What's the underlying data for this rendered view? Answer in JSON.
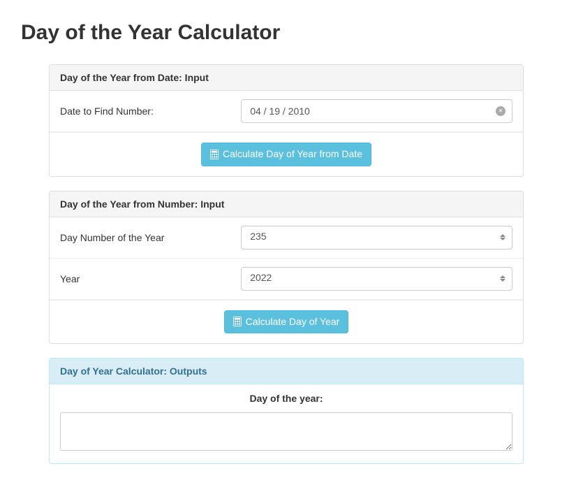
{
  "page_title": "Day of the Year Calculator",
  "panel1": {
    "heading": "Day of the Year from Date: Input",
    "date_label": "Date to Find Number:",
    "date_value": "04 / 19 / 2010",
    "button_label": "Calculate Day of Year from Date"
  },
  "panel2": {
    "heading": "Day of the Year from Number: Input",
    "daynum_label": "Day Number of the Year",
    "daynum_value": "235",
    "year_label": "Year",
    "year_value": "2022",
    "button_label": "Calculate Day of Year"
  },
  "panel3": {
    "heading": "Day of Year Calculator: Outputs",
    "output_label": "Day of the year:",
    "output_value": ""
  },
  "colors": {
    "button_bg": "#5bc0de",
    "info_bg": "#d9edf7"
  }
}
